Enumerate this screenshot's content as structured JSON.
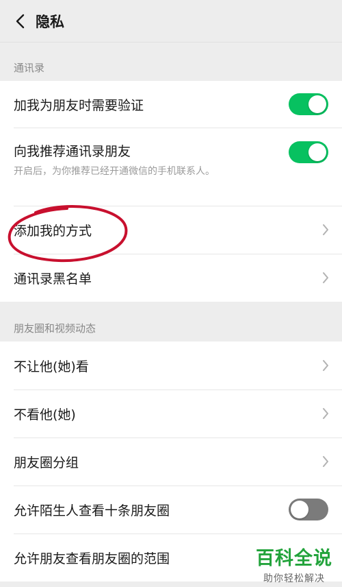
{
  "header": {
    "title": "隐私"
  },
  "colors": {
    "accent": "#07c160",
    "toggle_off": "#7b7b7b",
    "annotation": "#c8102e"
  },
  "sections": {
    "contacts": {
      "label": "通讯录",
      "items": [
        {
          "label": "加我为朋友时需要验证",
          "type": "toggle",
          "on": true
        },
        {
          "label": "向我推荐通讯录朋友",
          "type": "toggle",
          "on": true,
          "sub": "开启后，为你推荐已经开通微信的手机联系人。"
        },
        {
          "label": "添加我的方式",
          "type": "link"
        },
        {
          "label": "通讯录黑名单",
          "type": "link"
        }
      ]
    },
    "moments": {
      "label": "朋友圈和视频动态",
      "items": [
        {
          "label": "不让他(她)看",
          "type": "link"
        },
        {
          "label": "不看他(她)",
          "type": "link"
        },
        {
          "label": "朋友圈分组",
          "type": "link"
        },
        {
          "label": "允许陌生人查看十条朋友圈",
          "type": "toggle",
          "on": false
        },
        {
          "label": "允许朋友查看朋友圈的范围",
          "type": "link"
        }
      ]
    }
  },
  "watermark": {
    "title": "百科全说",
    "subtitle": "助你轻松解决"
  }
}
